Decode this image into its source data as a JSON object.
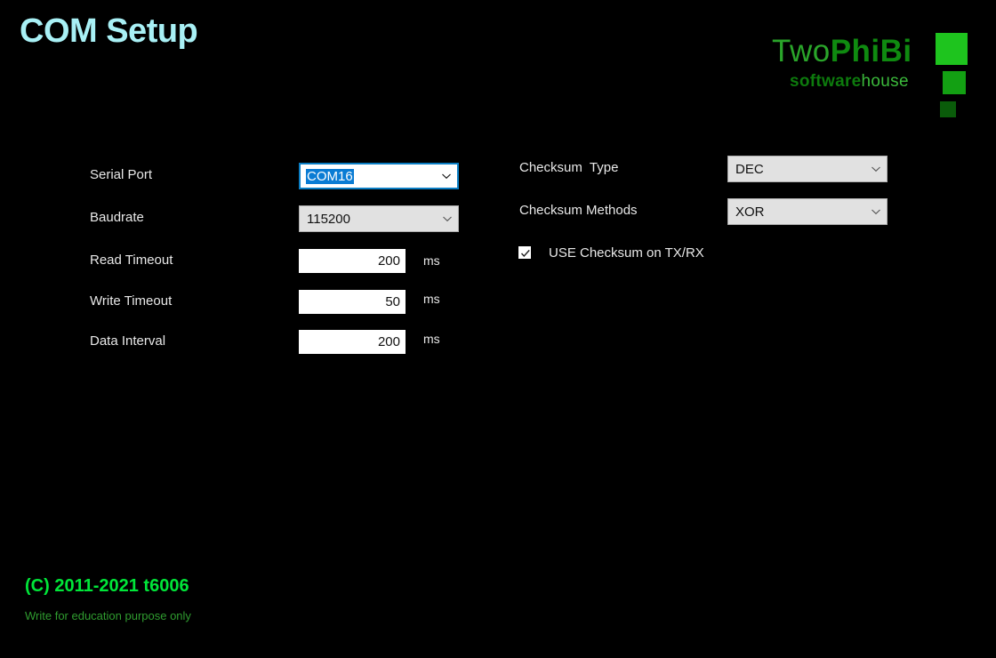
{
  "page": {
    "title": "COM Setup",
    "background_color": "#000000",
    "title_color": "#a8f0f5"
  },
  "logo": {
    "word_part1": "Two",
    "word_part2": "PhiBi",
    "sub_part1": "software",
    "sub_part2": "house",
    "square_large_color": "#1ec41e",
    "square_medium_color": "#13a013",
    "square_small_color": "#0a5c0a"
  },
  "form": {
    "left_column": [
      {
        "label": "Serial Port",
        "control": "combobox",
        "value": "COM16",
        "focused": true,
        "unit": ""
      },
      {
        "label": "Baudrate",
        "control": "combobox",
        "value": "115200",
        "focused": false,
        "unit": ""
      },
      {
        "label": "Read Timeout",
        "control": "textinput",
        "value": "200",
        "unit": "ms"
      },
      {
        "label": "Write Timeout",
        "control": "textinput",
        "value": "50",
        "unit": "ms"
      },
      {
        "label": "Data Interval",
        "control": "textinput",
        "value": "200",
        "unit": "ms"
      }
    ],
    "right_column": [
      {
        "label": "Checksum  Type",
        "control": "combobox",
        "value": "DEC"
      },
      {
        "label": "Checksum Methods",
        "control": "combobox",
        "value": "XOR"
      }
    ],
    "checkbox": {
      "label": "USE Checksum on TX/RX",
      "checked": true
    }
  },
  "footer": {
    "copyright": "(C) 2011-2021 t6006",
    "note": "Write for education purpose only",
    "copyright_color": "#00e639",
    "note_color": "#2f9c2f"
  }
}
